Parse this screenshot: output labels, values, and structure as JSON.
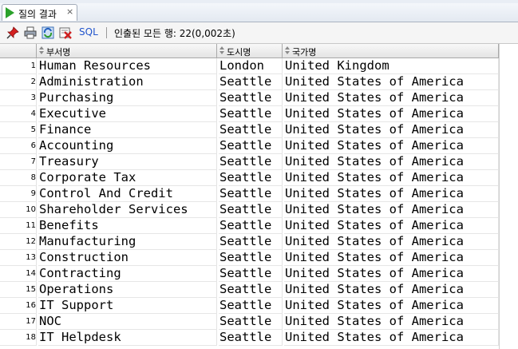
{
  "tab": {
    "label": "질의 결과",
    "close": "×"
  },
  "toolbar": {
    "sql_label": "SQL",
    "status": "인출된 모든 행: 22(0,002초)"
  },
  "columns": [
    "부서명",
    "도시명",
    "국가명"
  ],
  "rows": [
    {
      "n": "1",
      "dept": "Human Resources",
      "city": "London",
      "country": "United Kingdom"
    },
    {
      "n": "2",
      "dept": "Administration",
      "city": "Seattle",
      "country": "United States of America"
    },
    {
      "n": "3",
      "dept": "Purchasing",
      "city": "Seattle",
      "country": "United States of America"
    },
    {
      "n": "4",
      "dept": "Executive",
      "city": "Seattle",
      "country": "United States of America"
    },
    {
      "n": "5",
      "dept": "Finance",
      "city": "Seattle",
      "country": "United States of America"
    },
    {
      "n": "6",
      "dept": "Accounting",
      "city": "Seattle",
      "country": "United States of America"
    },
    {
      "n": "7",
      "dept": "Treasury",
      "city": "Seattle",
      "country": "United States of America"
    },
    {
      "n": "8",
      "dept": "Corporate Tax",
      "city": "Seattle",
      "country": "United States of America"
    },
    {
      "n": "9",
      "dept": "Control And Credit",
      "city": "Seattle",
      "country": "United States of America"
    },
    {
      "n": "10",
      "dept": "Shareholder Services",
      "city": "Seattle",
      "country": "United States of America"
    },
    {
      "n": "11",
      "dept": "Benefits",
      "city": "Seattle",
      "country": "United States of America"
    },
    {
      "n": "12",
      "dept": "Manufacturing",
      "city": "Seattle",
      "country": "United States of America"
    },
    {
      "n": "13",
      "dept": "Construction",
      "city": "Seattle",
      "country": "United States of America"
    },
    {
      "n": "14",
      "dept": "Contracting",
      "city": "Seattle",
      "country": "United States of America"
    },
    {
      "n": "15",
      "dept": "Operations",
      "city": "Seattle",
      "country": "United States of America"
    },
    {
      "n": "16",
      "dept": "IT Support",
      "city": "Seattle",
      "country": "United States of America"
    },
    {
      "n": "17",
      "dept": "NOC",
      "city": "Seattle",
      "country": "United States of America"
    },
    {
      "n": "18",
      "dept": "IT Helpdesk",
      "city": "Seattle",
      "country": "United States of America"
    }
  ],
  "icons": [
    "run-icon",
    "pin-icon",
    "print-icon",
    "refresh-icon",
    "export-excel-icon",
    "sort-icon"
  ]
}
